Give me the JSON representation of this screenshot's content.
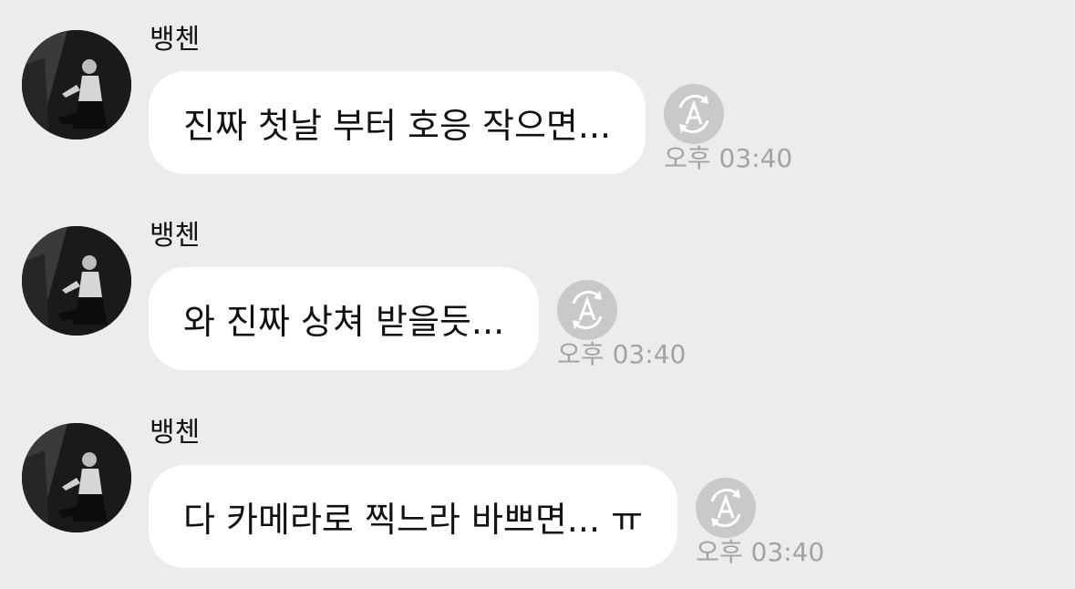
{
  "messages": [
    {
      "sender": "뱅첸",
      "text": "진짜 첫날 부터 호응 작으면...",
      "time": "오후 03:40",
      "avatar_icon": "profile-photo",
      "action_icon": "translate-icon"
    },
    {
      "sender": "뱅첸",
      "text": "와 진짜 상쳐 받을듯...",
      "time": "오후 03:40",
      "avatar_icon": "profile-photo",
      "action_icon": "translate-icon"
    },
    {
      "sender": "뱅첸",
      "text": "다 카메라로 찍느라 바쁘면... ㅠ",
      "time": "오후 03:40",
      "avatar_icon": "profile-photo",
      "action_icon": "translate-icon"
    }
  ],
  "colors": {
    "background": "#ececec",
    "bubble": "#ffffff",
    "timestamp": "#a3a3a3",
    "translate_button": "#c9c9c9"
  }
}
